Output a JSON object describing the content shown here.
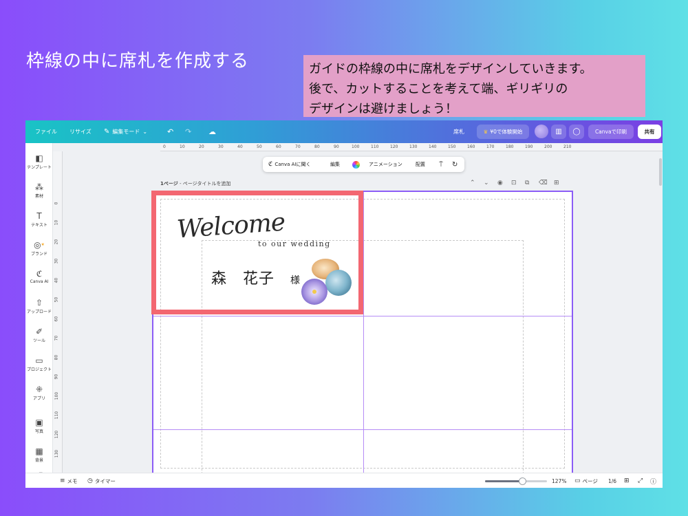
{
  "slide": {
    "title": "枠線の中に席札を作成する",
    "note": "ガイドの枠線の中に席札をデザインしていきます。\n後で、カットすることを考えて端、ギリギリの\nデザインは避けましょう！"
  },
  "topbar": {
    "file": "ファイル",
    "resize": "リサイズ",
    "edit_mode": "編集モード",
    "doc_title": "席札",
    "trial": "¥0で体験開始",
    "print": "Canvaで印刷",
    "share": "共有"
  },
  "sidebar": {
    "items": [
      {
        "label": "テンプレート",
        "icon": "template-icon"
      },
      {
        "label": "素材",
        "icon": "elements-icon"
      },
      {
        "label": "テキスト",
        "icon": "text-icon"
      },
      {
        "label": "ブランド",
        "icon": "brand-icon"
      },
      {
        "label": "Canva AI",
        "icon": "canva-ai-icon"
      },
      {
        "label": "アップロード",
        "icon": "upload-icon"
      },
      {
        "label": "ツール",
        "icon": "tools-icon"
      },
      {
        "label": "プロジェクト",
        "icon": "folder-icon"
      },
      {
        "label": "アプリ",
        "icon": "apps-icon"
      },
      {
        "label": "写真",
        "icon": "photo-icon"
      },
      {
        "label": "背景",
        "icon": "background-icon"
      }
    ]
  },
  "ruler": {
    "top": [
      "0",
      "10",
      "20",
      "30",
      "40",
      "50",
      "60",
      "70",
      "80",
      "90",
      "100",
      "110",
      "120",
      "130",
      "140",
      "150",
      "160",
      "170",
      "180",
      "190",
      "200",
      "210"
    ],
    "left": [
      "0",
      "10",
      "20",
      "30",
      "40",
      "50",
      "60",
      "70",
      "80",
      "90",
      "100",
      "110",
      "120",
      "130"
    ]
  },
  "float_toolbar": {
    "canva_ai": "Canva AIに聞く",
    "edit": "編集",
    "animation": "アニメーション",
    "arrange": "配置"
  },
  "page": {
    "label": "1ページ",
    "title_placeholder": "ページタイトルを追加"
  },
  "card": {
    "welcome": "Welcome",
    "subtitle": "to our wedding",
    "name": "森　花子",
    "honorific": "様"
  },
  "bottombar": {
    "notes": "メモ",
    "timer": "タイマー",
    "zoom": "127%",
    "pages": "ページ",
    "page_count": "1/6",
    "zoom_level": 0.6
  },
  "colors": {
    "highlight_frame": "#f36771",
    "guide_lines": "#8b5cf6",
    "note_bg": "#e3a0c8"
  }
}
